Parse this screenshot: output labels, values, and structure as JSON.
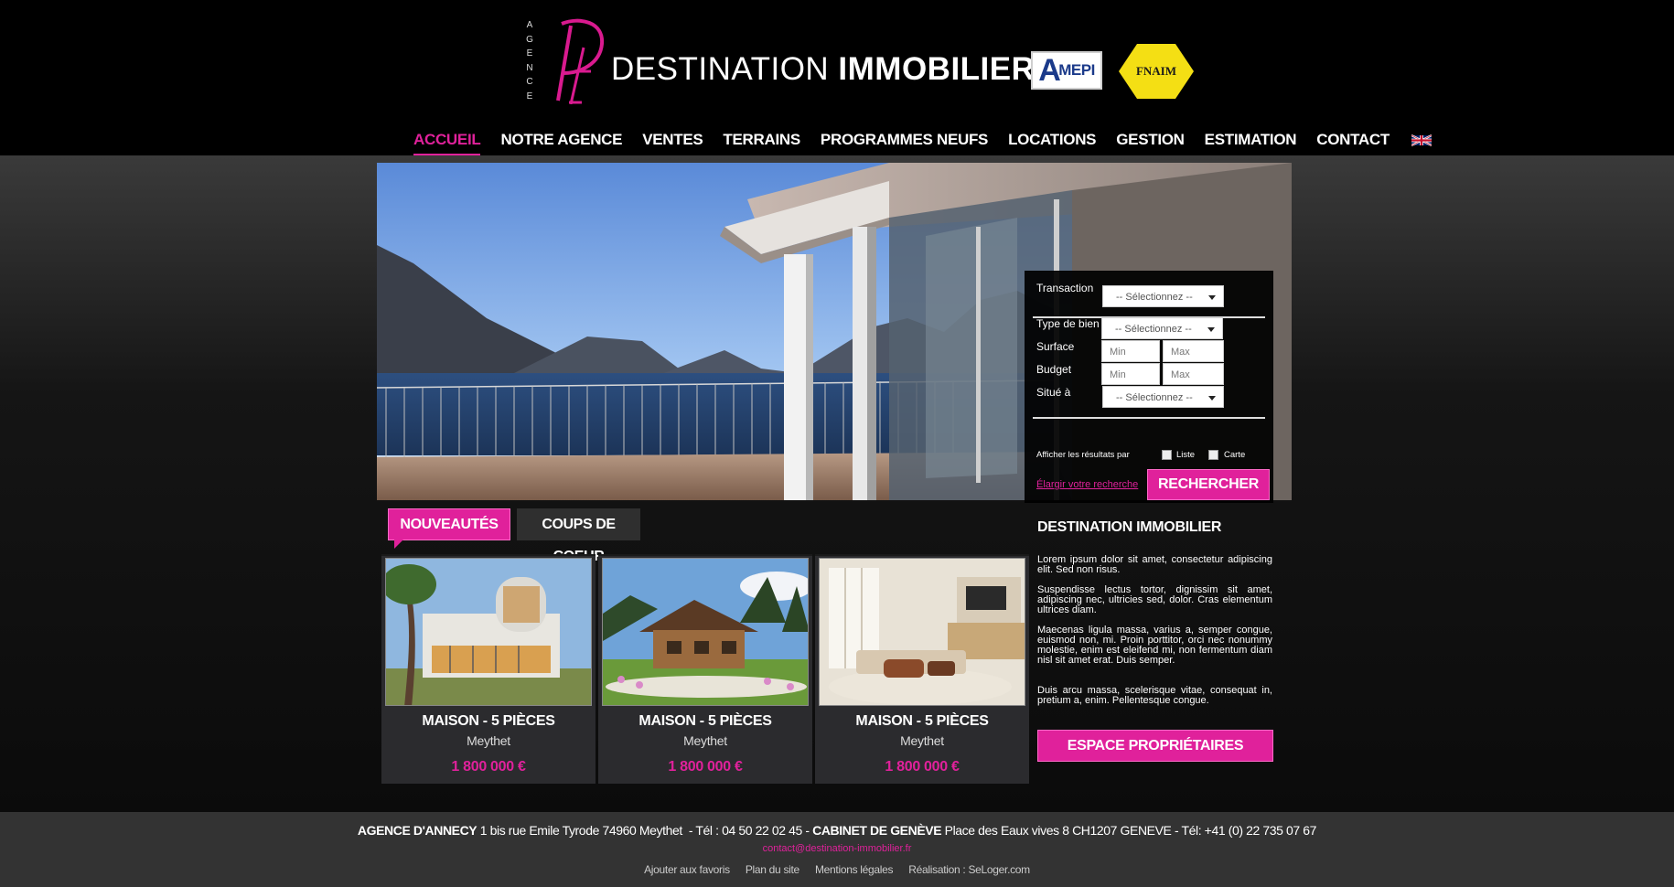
{
  "header": {
    "logo_vertical": "AGENCE",
    "logo_light": "DESTINATION ",
    "logo_bold": "IMMOBILIER",
    "amepi": "MEPI",
    "amepi_initial": "A",
    "fnaim": "FNAIM"
  },
  "nav": {
    "items": [
      "ACCUEIL",
      "NOTRE AGENCE",
      "VENTES",
      "TERRAINS",
      "PROGRAMMES NEUFS",
      "LOCATIONS",
      "GESTION",
      "ESTIMATION",
      "CONTACT"
    ],
    "active": "ACCUEIL",
    "flag_icon": "uk-flag-icon"
  },
  "search": {
    "transaction_label": "Transaction",
    "transaction_value": "-- Sélectionnez --",
    "type_label": "Type de bien",
    "type_value": "-- Sélectionnez --",
    "surface_label": "Surface",
    "surface_min": "Min",
    "surface_max": "Max",
    "budget_label": "Budget",
    "budget_min": "Min",
    "budget_max": "Max",
    "situe_label": "Situé à",
    "situe_value": "-- Sélectionnez --",
    "afficher_label": "Afficher les résultats par",
    "liste_label": "Liste",
    "carte_label": "Carte",
    "elargir": "Élargir votre recherche",
    "button": "RECHERCHER"
  },
  "tabs": {
    "nouveautes": "NOUVEAUTÉS",
    "coups": "COUPS DE COEUR"
  },
  "listings": [
    {
      "title": "MAISON - 5 PIÈCES",
      "city": "Meythet",
      "price": "1 800 000 €"
    },
    {
      "title": "MAISON - 5 PIÈCES",
      "city": "Meythet",
      "price": "1 800 000 €"
    },
    {
      "title": "MAISON - 5 PIÈCES",
      "city": "Meythet",
      "price": "1 800 000 €"
    }
  ],
  "about": {
    "title": "DESTINATION IMMOBILIER",
    "p1": "Lorem ipsum dolor sit amet, consectetur adipiscing elit. Sed non risus.",
    "p2": "Suspendisse lectus tortor, dignissim sit amet, adipiscing nec, ultricies sed, dolor. Cras elementum ultrices diam.",
    "p3": "Maecenas ligula massa, varius a, semper congue, euismod non, mi. Proin porttitor, orci nec nonummy molestie, enim est eleifend mi, non fermentum diam nisl sit amet erat. Duis semper.",
    "p4": "Duis arcu massa, scelerisque vitae, consequat in, pretium a, enim. Pellentesque congue.",
    "button": "ESPACE PROPRIÉTAIRES"
  },
  "footer": {
    "annecy_label": "AGENCE D'ANNECY",
    "annecy_text": " 1 bis rue Emile Tyrode 74960 Meythet  - Tél : 04 50 22 02 45 - ",
    "geneve_label": "CABINET DE GENÈVE",
    "geneve_text": " Place des Eaux vives 8 CH1207 GENEVE - Tél: +41 (0) 22 735 07 67",
    "email": "contact@destination-immobilier.fr",
    "links": [
      "Ajouter aux favoris",
      "Plan du site",
      "Mentions légales",
      "Réalisation : SeLoger.com"
    ]
  },
  "colors": {
    "accent": "#e0219b",
    "background": "#000000",
    "footer": "#333333"
  }
}
